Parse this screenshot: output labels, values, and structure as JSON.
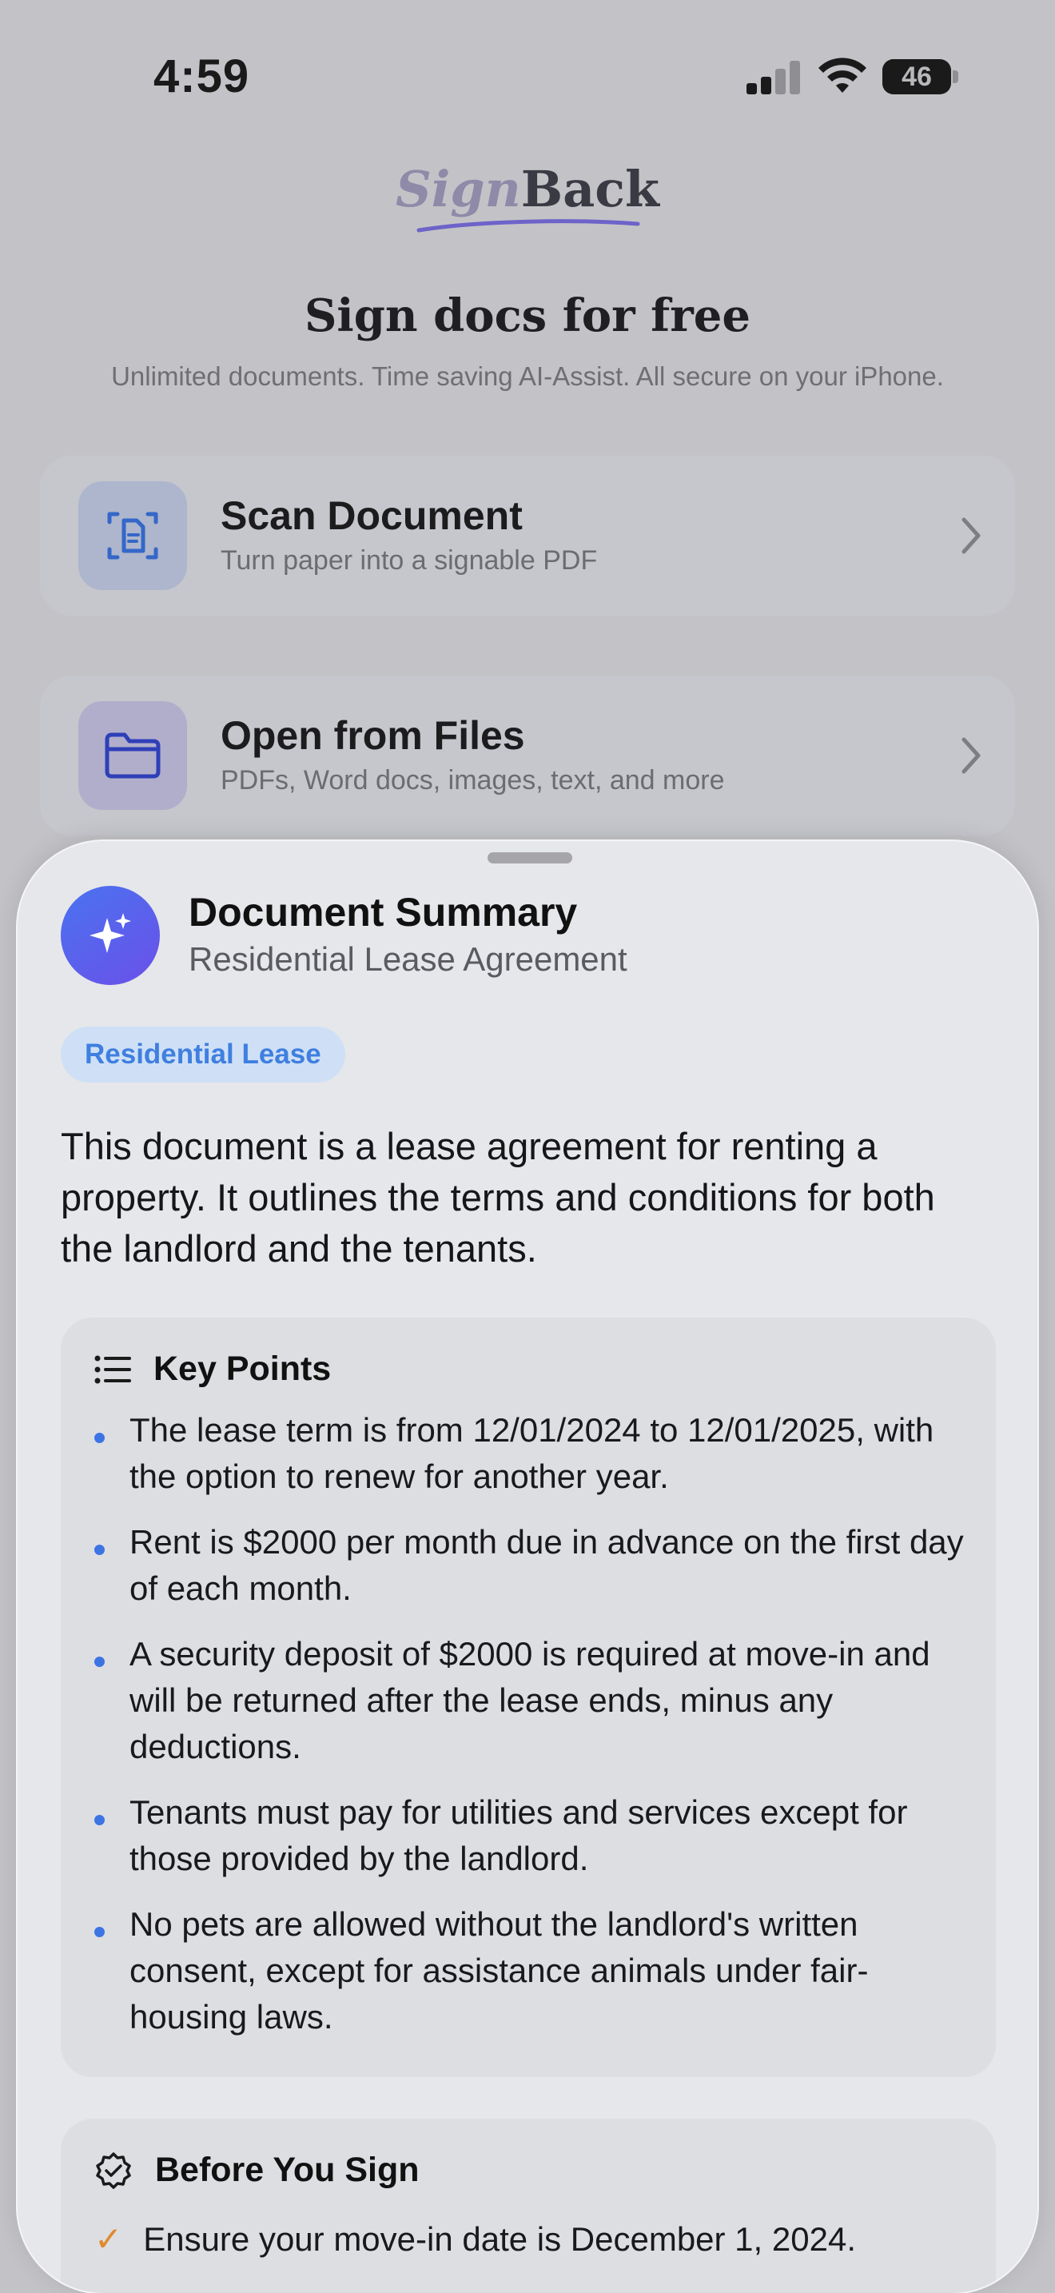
{
  "status_bar": {
    "time": "4:59",
    "battery_level": "46",
    "battery_fraction": 0.46,
    "signal_bars_active": 2,
    "signal_bars_total": 4,
    "wifi": true
  },
  "header": {
    "logo_part1": "Sign",
    "logo_part2": "Back",
    "title": "Sign docs for free",
    "subtitle": "Unlimited documents. Time saving AI-Assist. All secure on your iPhone."
  },
  "actions": [
    {
      "title": "Scan Document",
      "subtitle": "Turn paper into a signable PDF",
      "icon": "scan-document-icon"
    },
    {
      "title": "Open from Files",
      "subtitle": "PDFs, Word docs, images, text, and more",
      "icon": "folder-icon"
    }
  ],
  "sheet": {
    "title": "Document Summary",
    "subtitle": "Residential Lease Agreement",
    "avatar_icon": "sparkles-icon",
    "tag": "Residential Lease",
    "body": "This document is a lease agreement for renting a property. It outlines the terms and conditions for both the landlord and the tenants.",
    "key_points": {
      "title": "Key Points",
      "icon": "list-icon",
      "items": [
        "The lease term is from 12/01/2024 to 12/01/2025, with the option to renew for another year.",
        "Rent is $2000 per month due in advance on the first day of each month.",
        "A security deposit of $2000 is required at move-in and will be returned after the lease ends, minus any deductions.",
        "Tenants must pay for utilities and services except for those provided by the landlord.",
        "No pets are allowed without the landlord's written consent, except for assistance animals under fair-housing laws."
      ]
    },
    "before_you_sign": {
      "title": "Before You Sign",
      "icon": "checkmark-seal-icon",
      "items": [
        "Ensure your move-in date is December 1, 2024."
      ]
    }
  },
  "colors": {
    "accent_blue": "#3d74e4",
    "tag_background": "#cfe0f6",
    "check_orange": "#e08a2c",
    "sheet_background": "#e6e7ea",
    "dimmed_background": "#c3c3c7"
  }
}
